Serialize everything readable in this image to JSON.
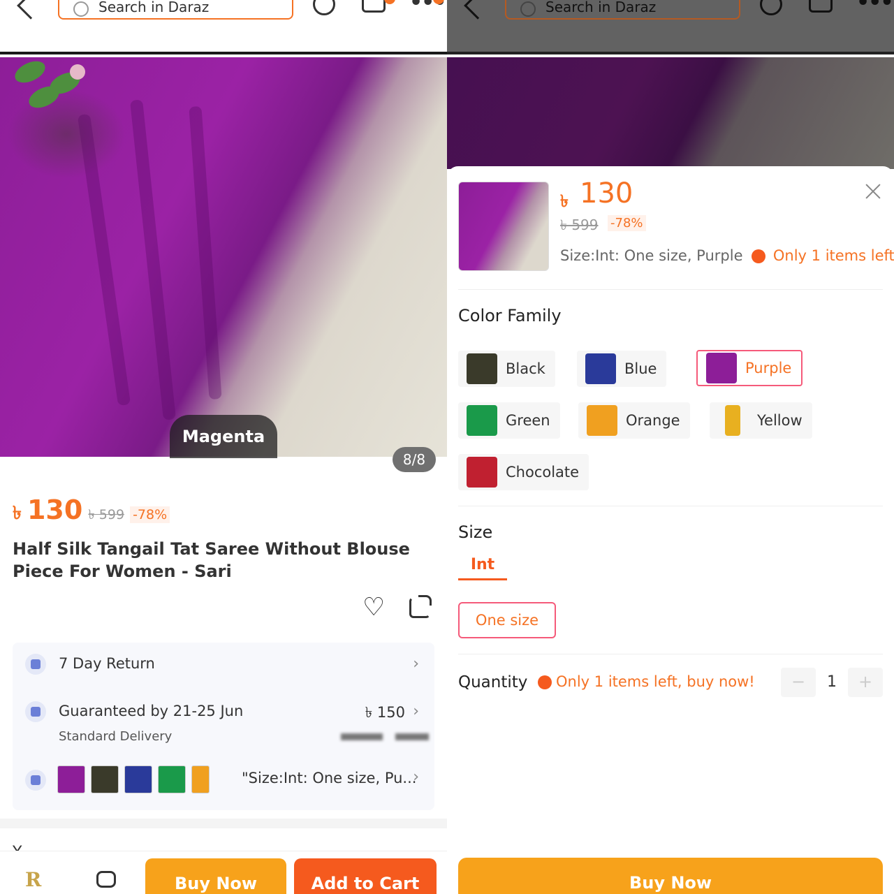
{
  "search": {
    "placeholder": "Search in Daraz"
  },
  "product": {
    "image_tag": "Magenta",
    "image_counter": "8/8",
    "currency": "৳",
    "price": "130",
    "original_price": "৳ 599",
    "discount": "-78%",
    "title": "Half Silk Tangail Tat Saree Without Blouse Piece For Women - Sari"
  },
  "info": {
    "return_label": "7 Day Return",
    "delivery_label": "Guaranteed by 21-25 Jun",
    "delivery_sub": "Standard Delivery",
    "delivery_price": "৳ 150",
    "variant_summary": "\"Size:Int: One size, Pu..."
  },
  "bottom_bar": {
    "buy_now": "Buy Now",
    "add_to_cart": "Add to Cart"
  },
  "sheet": {
    "currency": "৳",
    "price": "130",
    "original_price": "৳ 599",
    "discount": "-78%",
    "selection": "Size:Int: One size, Purple",
    "stock": "Only 1 items left",
    "color_family_title": "Color Family",
    "colors": [
      {
        "label": "Black",
        "swatch": "#3a3a2a"
      },
      {
        "label": "Blue",
        "swatch": "#2a3a9a"
      },
      {
        "label": "Purple",
        "swatch": "#8d1e98",
        "selected": true
      },
      {
        "label": "Green",
        "swatch": "#1a9a4a"
      },
      {
        "label": "Orange",
        "swatch": "#f0a020"
      },
      {
        "label": "Yellow",
        "swatch": "#e8b020"
      },
      {
        "label": "Chocolate",
        "swatch": "#c02030"
      }
    ],
    "size_title": "Size",
    "size_tab": "Int",
    "size_option": "One size",
    "quantity_title": "Quantity",
    "quantity_warning": "Only 1 items left, buy now!",
    "quantity_minus": "−",
    "quantity_value": "1",
    "quantity_plus": "+",
    "buy_now": "Buy Now"
  },
  "colors": {
    "accent": "#f57224",
    "buy": "#f7a21b",
    "cart": "#f55a1e"
  }
}
